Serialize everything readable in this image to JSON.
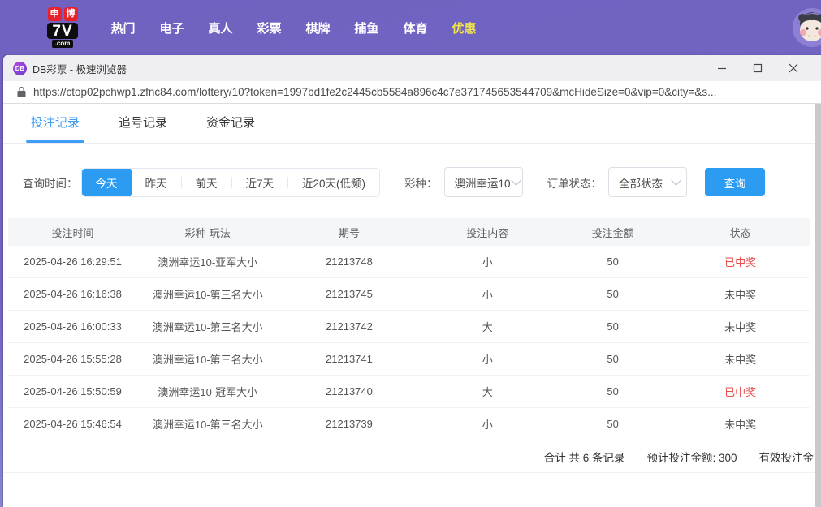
{
  "site_nav": {
    "logo": {
      "badge1": "申",
      "badge2": "博",
      "main": "7V",
      "suffix": ".com"
    },
    "items": [
      {
        "key": "hot",
        "label": "热门",
        "active": false
      },
      {
        "key": "slots",
        "label": "电子",
        "active": false
      },
      {
        "key": "live",
        "label": "真人",
        "active": false
      },
      {
        "key": "lottery",
        "label": "彩票",
        "active": false
      },
      {
        "key": "board",
        "label": "棋牌",
        "active": false
      },
      {
        "key": "fishing",
        "label": "捕鱼",
        "active": false
      },
      {
        "key": "sports",
        "label": "体育",
        "active": false
      },
      {
        "key": "promo",
        "label": "优惠",
        "active": true
      }
    ]
  },
  "browser": {
    "icon_text": "DB",
    "window_title": "DB彩票 - 极速浏览器",
    "url": "https://ctop02pchwp1.zfnc84.com/lottery/10?token=1997bd1fe2c2445cb5584a896c4c7e371745653544709&mcHideSize=0&vip=0&city=&s..."
  },
  "tabs": [
    {
      "key": "bet-records",
      "label": "投注记录",
      "active": true
    },
    {
      "key": "chase-records",
      "label": "追号记录",
      "active": false
    },
    {
      "key": "fund-records",
      "label": "资金记录",
      "active": false
    }
  ],
  "filters": {
    "time_label": "查询时间：",
    "time_options": [
      {
        "key": "today",
        "label": "今天",
        "active": true
      },
      {
        "key": "yesterday",
        "label": "昨天",
        "active": false
      },
      {
        "key": "day-before",
        "label": "前天",
        "active": false
      },
      {
        "key": "last-7",
        "label": "近7天",
        "active": false
      },
      {
        "key": "last-20",
        "label": "近20天(低频)",
        "active": false
      }
    ],
    "lottery_label": "彩种：",
    "lottery_value": "澳洲幸运10",
    "order_status_label": "订单状态：",
    "order_status_value": "全部状态",
    "search_button": "查询"
  },
  "table": {
    "headers": [
      "投注时间",
      "彩种-玩法",
      "期号",
      "投注内容",
      "投注金额",
      "状态"
    ],
    "rows": [
      {
        "time": "2025-04-26 16:29:51",
        "game": "澳洲幸运10-亚军大小",
        "period": "21213748",
        "content": "小",
        "amount": "50",
        "status": "已中奖",
        "won": true
      },
      {
        "time": "2025-04-26 16:16:38",
        "game": "澳洲幸运10-第三名大小",
        "period": "21213745",
        "content": "小",
        "amount": "50",
        "status": "未中奖",
        "won": false
      },
      {
        "time": "2025-04-26 16:00:33",
        "game": "澳洲幸运10-第三名大小",
        "period": "21213742",
        "content": "大",
        "amount": "50",
        "status": "未中奖",
        "won": false
      },
      {
        "time": "2025-04-26 15:55:28",
        "game": "澳洲幸运10-第三名大小",
        "period": "21213741",
        "content": "小",
        "amount": "50",
        "status": "未中奖",
        "won": false
      },
      {
        "time": "2025-04-26 15:50:59",
        "game": "澳洲幸运10-冠军大小",
        "period": "21213740",
        "content": "大",
        "amount": "50",
        "status": "已中奖",
        "won": true
      },
      {
        "time": "2025-04-26 15:46:54",
        "game": "澳洲幸运10-第三名大小",
        "period": "21213739",
        "content": "小",
        "amount": "50",
        "status": "未中奖",
        "won": false
      }
    ]
  },
  "summary": {
    "total_records": "合计 共 6 条记录",
    "expected_amount": "预计投注金额: 300",
    "valid_amount": "有效投注金"
  },
  "colors": {
    "accent_blue": "#2b9cf2",
    "tab_blue": "#3f9ef8",
    "win_red": "#e84b4b",
    "nav_purple": "#7265c2",
    "promo_yellow": "#f0e24c"
  }
}
